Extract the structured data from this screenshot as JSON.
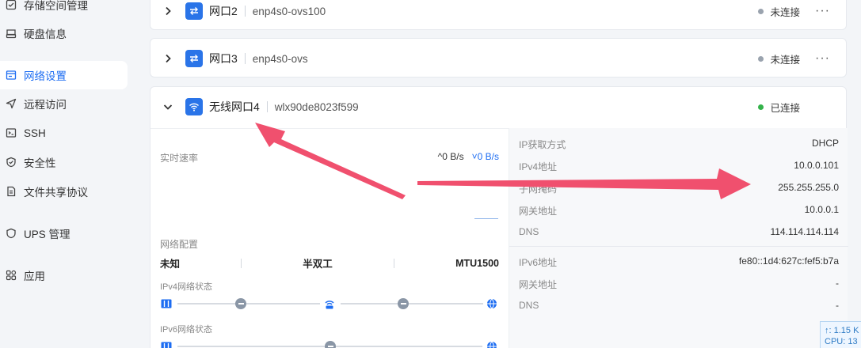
{
  "sidebar": {
    "items": [
      {
        "label": "存储空间管理",
        "icon": "storage-icon"
      },
      {
        "label": "硬盘信息",
        "icon": "disk-icon"
      },
      {
        "label": "网络设置",
        "icon": "network-icon",
        "active": true
      },
      {
        "label": "远程访问",
        "icon": "send-icon"
      },
      {
        "label": "SSH",
        "icon": "terminal-icon"
      },
      {
        "label": "安全性",
        "icon": "shield-icon"
      },
      {
        "label": "文件共享协议",
        "icon": "file-share-icon"
      },
      {
        "label": "UPS 管理",
        "icon": "ups-shield-icon"
      },
      {
        "label": "应用",
        "icon": "apps-icon"
      }
    ]
  },
  "ports": [
    {
      "name": "网口2",
      "device": "enp4s0-ovs100",
      "status": "未连接",
      "status_color": "#9aa3ae",
      "icon": "ethernet-arrows-icon"
    },
    {
      "name": "网口3",
      "device": "enp4s0-ovs",
      "status": "未连接",
      "status_color": "#9aa3ae",
      "icon": "ethernet-arrows-icon"
    },
    {
      "name": "无线网口4",
      "device": "wlx90de8023f599",
      "status": "已连接",
      "status_color": "#33b24a",
      "icon": "wifi-icon"
    }
  ],
  "more_glyph": "···",
  "speed": {
    "label": "实时速率",
    "up": "^0 B/s",
    "down": "˅0 B/s"
  },
  "net_config": {
    "label": "网络配置",
    "speed_value": "未知",
    "duplex": "半双工",
    "mtu": "MTU1500"
  },
  "ipv4_status_label": "IPv4网络状态",
  "ipv6_status_label": "IPv6网络状态",
  "ipv4": {
    "method_label": "IP获取方式",
    "method": "DHCP",
    "addr_label": "IPv4地址",
    "addr": "10.0.0.101",
    "mask_label": "子网掩码",
    "mask": "255.255.255.0",
    "gateway_label": "网关地址",
    "gateway": "10.0.0.1",
    "dns_label": "DNS",
    "dns": "114.114.114.114"
  },
  "ipv6": {
    "addr_label": "IPv6地址",
    "addr": "fe80::1d4:627c:fef5:b7a",
    "gateway_label": "网关地址",
    "gateway": "-",
    "dns_label": "DNS",
    "dns": "-"
  },
  "tray": {
    "line1": "↑: 1.15 K",
    "line2": "CPU: 13"
  },
  "colors": {
    "accent": "#1d6df2",
    "annotation_arrow": "#f0506e"
  }
}
